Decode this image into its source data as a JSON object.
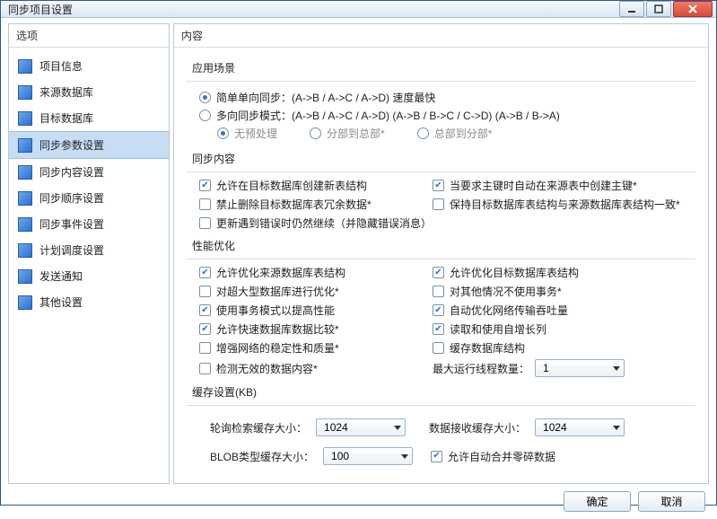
{
  "window": {
    "title": "同步项目设置"
  },
  "left": {
    "title": "选项",
    "items": [
      {
        "label": "项目信息"
      },
      {
        "label": "来源数据库"
      },
      {
        "label": "目标数据库"
      },
      {
        "label": "同步参数设置",
        "selected": true
      },
      {
        "label": "同步内容设置"
      },
      {
        "label": "同步顺序设置"
      },
      {
        "label": "同步事件设置"
      },
      {
        "label": "计划调度设置"
      },
      {
        "label": "发送通知"
      },
      {
        "label": "其他设置"
      }
    ]
  },
  "right": {
    "title": "内容",
    "scene": {
      "title": "应用场景",
      "simple": {
        "label": "简单单向同步：(A->B / A->C / A->D) 速度最快",
        "checked": true
      },
      "multi": {
        "label": "多向同步模式：(A->B / A->C / A->D) (A->B / B->C / C->D) (A->B / B->A)",
        "checked": false
      },
      "sub": [
        {
          "label": "无预处理",
          "checked": true
        },
        {
          "label": "分部到总部*",
          "checked": false
        },
        {
          "label": "总部到分部*",
          "checked": false
        }
      ]
    },
    "sync": {
      "title": "同步内容",
      "items": [
        {
          "label": "允许在目标数据库创建新表结构",
          "checked": true
        },
        {
          "label": "当要求主键时自动在来源表中创建主键*",
          "checked": true
        },
        {
          "label": "禁止删除目标数据库表冗余数据*",
          "checked": false
        },
        {
          "label": "保持目标数据库表结构与来源数据库表结构一致*",
          "checked": false
        },
        {
          "label": "更新遇到错误时仍然继续（并隐藏错误消息）",
          "checked": false
        }
      ]
    },
    "perf": {
      "title": "性能优化",
      "items": [
        {
          "label": "允许优化来源数据库表结构",
          "checked": true
        },
        {
          "label": "允许优化目标数据库表结构",
          "checked": true
        },
        {
          "label": "对超大型数据库进行优化*",
          "checked": false
        },
        {
          "label": "对其他情况不使用事务*",
          "checked": false
        },
        {
          "label": "使用事务模式以提高性能",
          "checked": true
        },
        {
          "label": "自动优化网络传输吞吐量",
          "checked": true
        },
        {
          "label": "允许快速数据库数据比较*",
          "checked": true
        },
        {
          "label": "读取和使用自增长列",
          "checked": true
        },
        {
          "label": "增强网络的稳定性和质量*",
          "checked": false
        },
        {
          "label": "缓存数据库结构",
          "checked": false
        },
        {
          "label": "检测无效的数据内容*",
          "checked": false
        }
      ],
      "maxthreads": {
        "label": "最大运行线程数量：",
        "value": "1"
      }
    },
    "buffer": {
      "title": "缓存设置(KB)",
      "poll": {
        "label": "轮询检索缓存大小：",
        "value": "1024"
      },
      "recv": {
        "label": "数据接收缓存大小：",
        "value": "1024"
      },
      "blob": {
        "label": "BLOB类型缓存大小：",
        "value": "100"
      },
      "merge": {
        "label": "允许自动合并零碎数据",
        "checked": true
      }
    }
  },
  "footer": {
    "ok": "确定",
    "cancel": "取消"
  }
}
